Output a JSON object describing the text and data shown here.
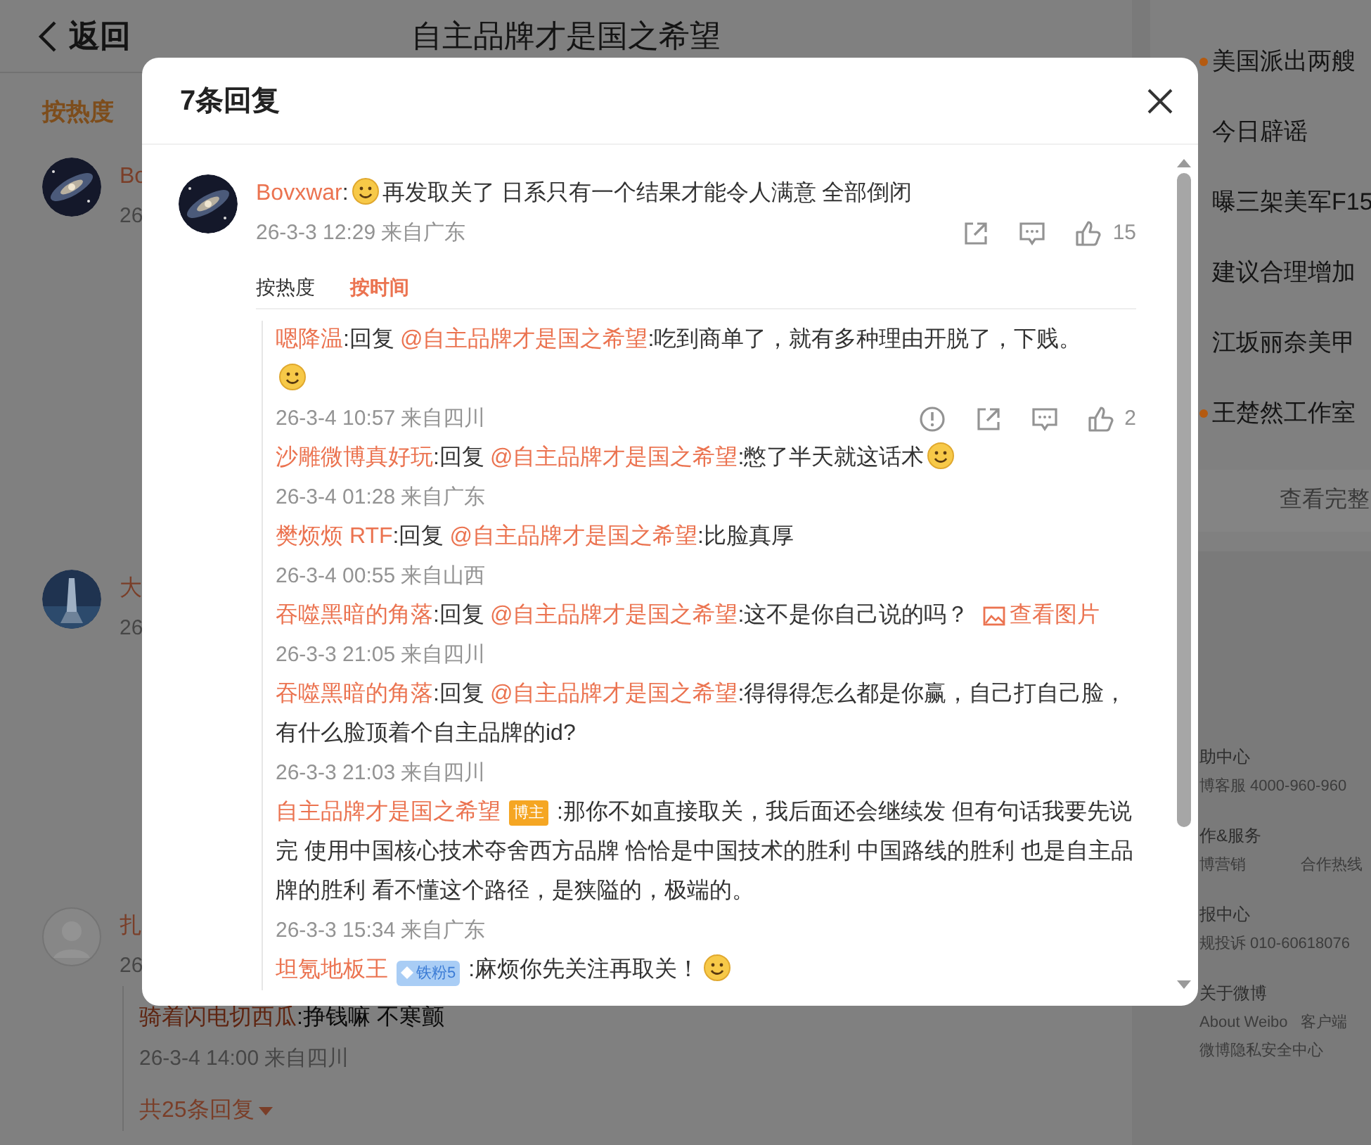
{
  "page": {
    "back": "返回",
    "title": "自主品牌才是国之希望",
    "sort": "按热度",
    "comments": [
      {
        "name": "Bo",
        "date": "26"
      },
      {
        "name": "大",
        "date": "26"
      },
      {
        "avatar": {
          "kind": "default"
        },
        "name": "扎",
        "date": "26",
        "reply": {
          "user": "骑着闪电切西瓜",
          "text": ":挣钱嘛 不寒颤",
          "date": "26-3-4 14:00 来自四川"
        },
        "more": "共25条回复"
      }
    ]
  },
  "sidebar": {
    "items": [
      {
        "text": "美国派出两艘",
        "hot": true
      },
      {
        "text": "今日辟谣",
        "hot": false
      },
      {
        "text": "曝三架美军F15",
        "hot": false
      },
      {
        "text": "建议合理增加",
        "hot": false
      },
      {
        "text": "江坂丽奈美甲",
        "hot": false
      },
      {
        "text": "王楚然工作室",
        "hot": true
      }
    ],
    "more": "查看完整",
    "footer": [
      {
        "heading": "助中心",
        "rows": [
          [
            "博客服 4000-960-960"
          ]
        ]
      },
      {
        "heading": "作&服务",
        "rows": [
          [
            "博营销",
            "合作热线"
          ]
        ]
      },
      {
        "heading": "报中心",
        "rows": [
          [
            "规投诉 010-60618076"
          ]
        ]
      },
      {
        "heading": "关于微博",
        "rows": [
          [
            "About Weibo",
            "客户端"
          ],
          [
            "微博隐私安全中心"
          ]
        ]
      }
    ]
  },
  "dialog": {
    "title": "7条回复",
    "comment": {
      "user": "Bovxwar",
      "segments": [
        {
          "kind": "text",
          "text": ":"
        },
        {
          "kind": "emoji"
        },
        {
          "kind": "text",
          "text": "再发取关了 日系只有一个结果才能令人满意 全部倒闭"
        }
      ],
      "date": "26-3-3 12:29 来自广东",
      "likes": "15"
    },
    "tabs": [
      {
        "label": "按热度",
        "selected": false
      },
      {
        "label": "按时间",
        "selected": true
      }
    ],
    "replies": [
      {
        "user": "嗯降温",
        "segments": [
          {
            "kind": "text",
            "text": ":回复"
          },
          {
            "kind": "mention",
            "text": "@自主品牌才是国之希望"
          },
          {
            "kind": "text",
            "text": ":吃到商单了，就有多种理由开脱了，下贱。"
          },
          {
            "kind": "break"
          },
          {
            "kind": "emoji"
          }
        ],
        "date": "26-3-4 10:57 来自四川",
        "likes": "2"
      },
      {
        "user": "沙雕微博真好玩",
        "segments": [
          {
            "kind": "text",
            "text": ":回复"
          },
          {
            "kind": "mention",
            "text": "@自主品牌才是国之希望"
          },
          {
            "kind": "text",
            "text": ":憋了半天就这话术"
          },
          {
            "kind": "emoji"
          }
        ],
        "date": "26-3-4 01:28 来自广东"
      },
      {
        "user": "樊烦烦 RTF",
        "segments": [
          {
            "kind": "text",
            "text": ":回复"
          },
          {
            "kind": "mention",
            "text": "@自主品牌才是国之希望"
          },
          {
            "kind": "text",
            "text": ":比脸真厚"
          }
        ],
        "date": "26-3-4 00:55 来自山西"
      },
      {
        "user": "吞噬黑暗的角落",
        "segments": [
          {
            "kind": "text",
            "text": ":回复"
          },
          {
            "kind": "mention",
            "text": "@自主品牌才是国之希望"
          },
          {
            "kind": "text",
            "text": ":这不是你自己说的吗？"
          },
          {
            "kind": "link",
            "text": "查看图片"
          }
        ],
        "date": "26-3-3 21:05 来自四川"
      },
      {
        "user": "吞噬黑暗的角落",
        "segments": [
          {
            "kind": "text",
            "text": ":回复"
          },
          {
            "kind": "mention",
            "text": "@自主品牌才是国之希望"
          },
          {
            "kind": "text",
            "text": ":得得得怎么都是你赢，自己打自己脸，有什么脸顶着个自主品牌的id?"
          }
        ],
        "date": "26-3-3 21:03 来自四川"
      },
      {
        "user": "自主品牌才是国之希望",
        "badge": {
          "text": "博主",
          "kind": "author"
        },
        "segments": [
          {
            "kind": "text",
            "text": ":那你不如直接取关，我后面还会继续发 但有句话我要先说完 使用中国核心技术夺舍西方品牌 恰恰是中国技术的胜利 中国路线的胜利 也是自主品牌的胜利 看不懂这个路径，是狭隘的，极端的。"
          }
        ],
        "date": "26-3-3 15:34 来自广东"
      },
      {
        "user": "坦氪地板王",
        "badge": {
          "text": "铁粉5",
          "kind": "fan"
        },
        "segments": [
          {
            "kind": "text",
            "text": ":麻烦你先关注再取关！"
          },
          {
            "kind": "emoji"
          }
        ]
      }
    ]
  }
}
